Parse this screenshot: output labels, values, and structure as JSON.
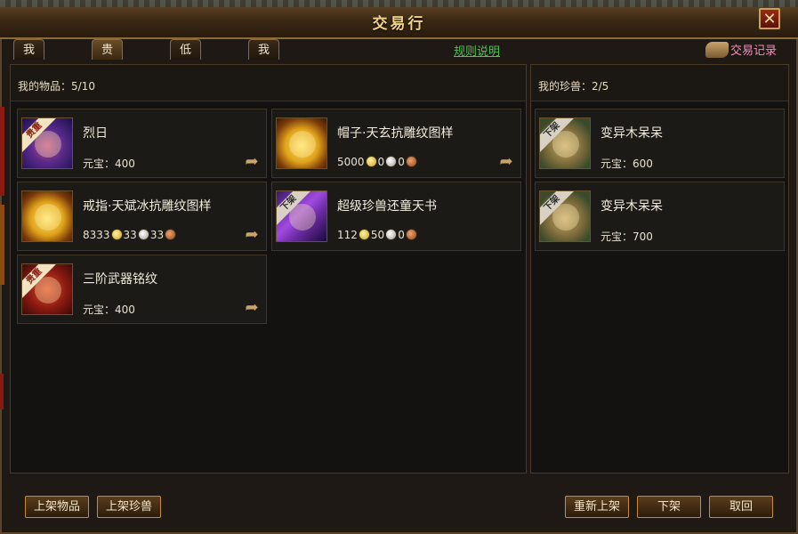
{
  "window": {
    "title": "交易行"
  },
  "tabs": [
    {
      "label": "我要购买"
    },
    {
      "label": "贵重公示"
    },
    {
      "label": "低价公示"
    },
    {
      "label": "我要出售"
    }
  ],
  "rules_link": "规则说明",
  "records_label": "交易记录",
  "items_panel": {
    "title": "我的物品：5/10",
    "items": [
      {
        "name": "烈日",
        "price_label": "元宝：",
        "price": "400",
        "ribbon": "贵重",
        "icon": "jewel-necklace-icon"
      },
      {
        "name": "帽子·天玄抗雕纹图样",
        "ribbon": "",
        "icon": "gold-scroll-icon",
        "coins": [
          "5000",
          "0",
          "0"
        ]
      },
      {
        "name": "戒指·天斌冰抗雕纹图样",
        "ribbon": "",
        "icon": "gold-scroll-icon",
        "coins": [
          "8333",
          "33",
          "33"
        ]
      },
      {
        "name": "超级珍兽还童天书",
        "ribbon": "下架",
        "icon": "magic-book-icon",
        "coins": [
          "112",
          "50",
          "0"
        ]
      },
      {
        "name": "三阶武器铭纹",
        "price_label": "元宝：",
        "price": "400",
        "ribbon": "贵重",
        "icon": "red-scroll-icon"
      }
    ]
  },
  "pets_panel": {
    "title": "我的珍兽：2/5",
    "items": [
      {
        "name": "变异木呆呆",
        "price_label": "元宝：",
        "price": "600",
        "ribbon": "下架",
        "icon": "wood-beast-icon"
      },
      {
        "name": "变异木呆呆",
        "price_label": "元宝：",
        "price": "700",
        "ribbon": "下架",
        "icon": "wood-beast-icon"
      }
    ]
  },
  "buttons": {
    "list_item": "上架物品",
    "list_pet": "上架珍兽",
    "relist": "重新上架",
    "delist": "下架",
    "cancel": "取回"
  },
  "colors": {
    "accent": "#f1d48a",
    "link": "#4ec24e",
    "records": "#f28dbd"
  }
}
